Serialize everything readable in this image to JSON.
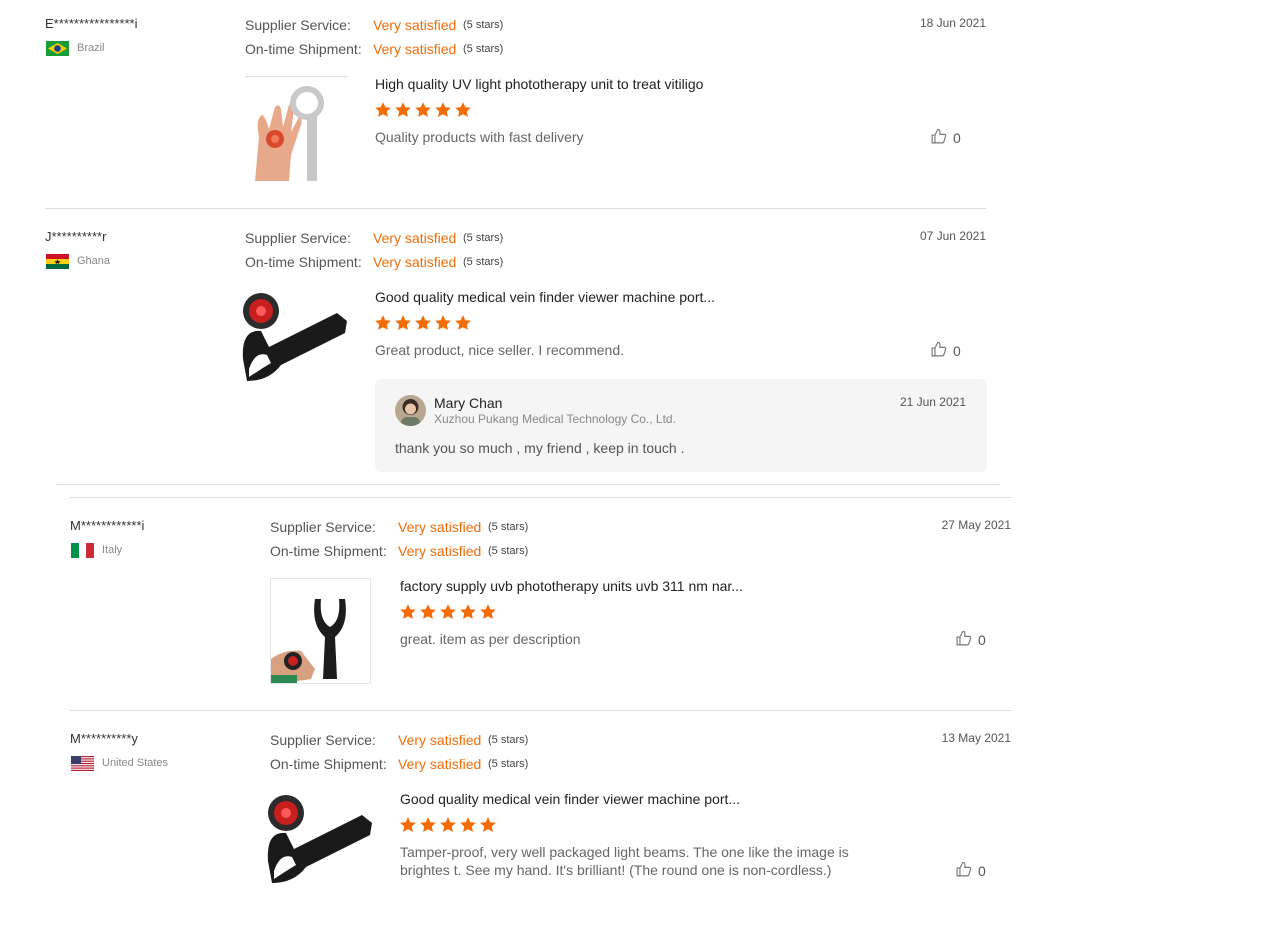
{
  "reviews": [
    {
      "user": "E****************i",
      "country": "Brazil",
      "supplier_label": "Supplier Service:",
      "supplier_value": "Very satisfied",
      "supplier_stars": "(5 stars)",
      "shipment_label": "On-time Shipment:",
      "shipment_value": "Very satisfied",
      "shipment_stars": "(5 stars)",
      "date": "18 Jun 2021",
      "product": "High quality UV light phototherapy unit to treat vitiligo",
      "rating": 5,
      "comment": "Quality products with fast delivery",
      "likes": "0"
    },
    {
      "user": "J**********r",
      "country": "Ghana",
      "supplier_label": "Supplier Service:",
      "supplier_value": "Very satisfied",
      "supplier_stars": "(5 stars)",
      "shipment_label": "On-time Shipment:",
      "shipment_value": "Very satisfied",
      "shipment_stars": "(5 stars)",
      "date": "07 Jun 2021",
      "product": "Good quality medical vein finder viewer machine port...",
      "rating": 5,
      "comment": "Great product, nice seller. I recommend.",
      "likes": "0",
      "reply": {
        "name": "Mary Chan",
        "company": "Xuzhou Pukang Medical Technology Co., Ltd.",
        "date": "21 Jun 2021",
        "text": "thank you so much , my friend , keep in touch ."
      }
    },
    {
      "user": "M************i",
      "country": "Italy",
      "supplier_label": "Supplier Service:",
      "supplier_value": "Very satisfied",
      "supplier_stars": "(5 stars)",
      "shipment_label": "On-time Shipment:",
      "shipment_value": "Very satisfied",
      "shipment_stars": "(5 stars)",
      "date": "27 May 2021",
      "product": "factory supply uvb phototherapy units uvb 311 nm nar...",
      "rating": 5,
      "comment": "great. item as per description",
      "likes": "0"
    },
    {
      "user": "M**********y",
      "country": "United States",
      "supplier_label": "Supplier Service:",
      "supplier_value": "Very satisfied",
      "supplier_stars": "(5 stars)",
      "shipment_label": "On-time Shipment:",
      "shipment_value": "Very satisfied",
      "shipment_stars": "(5 stars)",
      "date": "13 May 2021",
      "product": "Good quality medical vein finder viewer machine port...",
      "rating": 5,
      "comment": "Tamper-proof, very well packaged light beams. The one like the image is brightes t. See my hand. It's brilliant! (The round one is non-cordless.)",
      "likes": "0"
    }
  ],
  "colors": {
    "accent": "#f26c07",
    "divider": "#dddddd",
    "reply_bg": "#f5f5f5"
  }
}
